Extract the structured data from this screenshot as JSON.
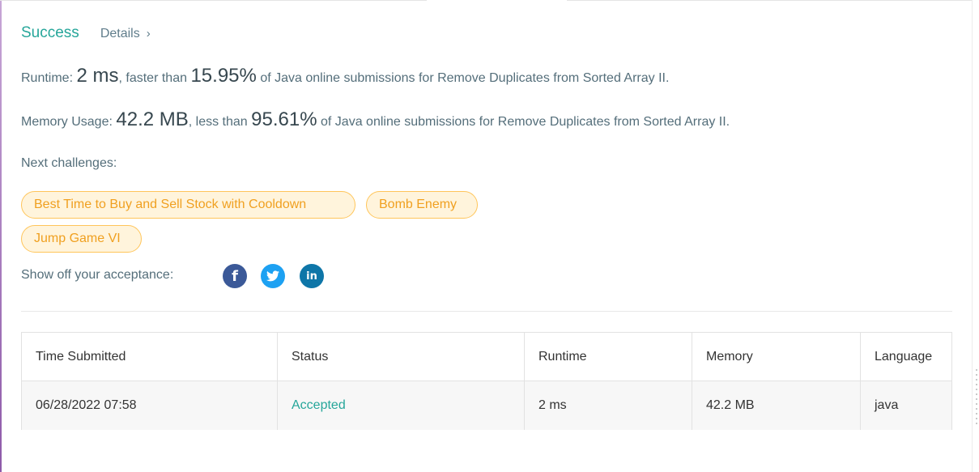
{
  "result": {
    "status": "Success",
    "details_label": "Details",
    "details_chevron": "›"
  },
  "runtime": {
    "label": "Runtime:",
    "value": "2 ms",
    "comparison": ", faster than",
    "percent": "15.95%",
    "suffix": "of Java online submissions for Remove Duplicates from Sorted Array II."
  },
  "memory": {
    "label": "Memory Usage:",
    "value": "42.2 MB",
    "comparison": ", less than",
    "percent": "95.61%",
    "suffix": "of Java online submissions for Remove Duplicates from Sorted Array II."
  },
  "next_challenges": {
    "label": "Next challenges:",
    "items": [
      {
        "label": "Best Time to Buy and Sell Stock with Cooldown"
      },
      {
        "label": "Bomb Enemy"
      },
      {
        "label": "Jump Game VI"
      }
    ]
  },
  "share": {
    "label": "Show off your acceptance:",
    "icons": [
      "facebook-icon",
      "twitter-icon",
      "linkedin-icon"
    ]
  },
  "table": {
    "headers": [
      "Time Submitted",
      "Status",
      "Runtime",
      "Memory",
      "Language"
    ],
    "rows": [
      [
        "06/28/2022 07:58",
        "Accepted",
        "2 ms",
        "42.2 MB",
        "java"
      ]
    ]
  },
  "colors": {
    "success": "#26a69a",
    "tag_border": "#ffc55a",
    "tag_bg": "#fff4dc",
    "tag_text": "#f0a020"
  }
}
